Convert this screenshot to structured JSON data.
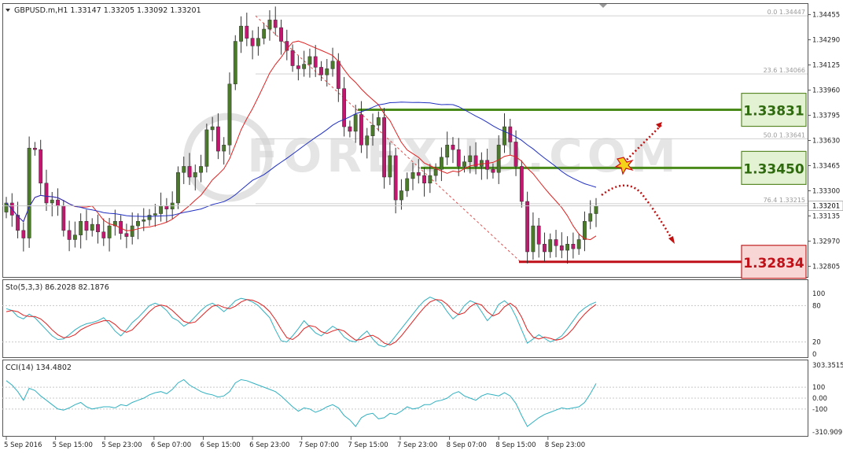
{
  "header": {
    "symbol_line": "GBPUSD.m,H1  1.33147 1.33205 1.33092 1.33201"
  },
  "watermark": "FOREX ID.COM",
  "colors": {
    "bull_candle": "#4a7a2a",
    "bear_candle": "#c0186e",
    "ma_fast": "#e02020",
    "ma_slow": "#2030c0",
    "stoch_main": "#30b0c0",
    "stoch_signal": "#e02020",
    "cci_line": "#30b0c0",
    "resistance": "#4a8a1a",
    "support": "#c0101a",
    "fib_line": "#e05050",
    "arrow": "#c01010"
  },
  "chart_data": [
    {
      "type": "candlestick",
      "title": "GBPUSD.m,H1",
      "ohlc_last": {
        "open": 1.33147,
        "high": 1.33205,
        "low": 1.33092,
        "close": 1.33201
      },
      "ylim": [
        1.3274,
        1.3452
      ],
      "y_ticks": [
        "1.34455",
        "1.34290",
        "1.34125",
        "1.33960",
        "1.33795",
        "1.33630",
        "1.33465",
        "1.33300",
        "1.33135",
        "1.32970",
        "1.32805"
      ],
      "current_price": "1.33201",
      "x_tick_labels": [
        "5 Sep 2016",
        "5 Sep 15:00",
        "5 Sep 23:00",
        "6 Sep 07:00",
        "6 Sep 15:00",
        "6 Sep 23:00",
        "7 Sep 07:00",
        "7 Sep 15:00",
        "7 Sep 23:00",
        "8 Sep 07:00",
        "8 Sep 15:00",
        "8 Sep 23:00"
      ],
      "fib_levels": [
        {
          "label": "0.0  1.34447",
          "value": 1.34447
        },
        {
          "label": "23.6  1.34066",
          "value": 1.34066
        },
        {
          "label": "50.0  1.33641",
          "value": 1.33641
        },
        {
          "label": "76.4  1.33215",
          "value": 1.33215
        }
      ],
      "annotated_levels": [
        {
          "label": "1.33831",
          "value": 1.33831,
          "kind": "resistance"
        },
        {
          "label": "1.33450",
          "value": 1.3345,
          "kind": "resistance"
        },
        {
          "label": "1.32834",
          "value": 1.32834,
          "kind": "support"
        }
      ],
      "closes": [
        1.3322,
        1.3314,
        1.3304,
        1.3299,
        1.3358,
        1.3357,
        1.3335,
        1.3322,
        1.3324,
        1.332,
        1.3304,
        1.3298,
        1.3301,
        1.331,
        1.3304,
        1.3308,
        1.3303,
        1.3299,
        1.3307,
        1.331,
        1.3302,
        1.33,
        1.3307,
        1.331,
        1.3311,
        1.3314,
        1.3315,
        1.332,
        1.3318,
        1.3322,
        1.3342,
        1.3346,
        1.3339,
        1.3342,
        1.3346,
        1.337,
        1.3372,
        1.3356,
        1.336,
        1.34,
        1.3428,
        1.3438,
        1.343,
        1.3425,
        1.343,
        1.3436,
        1.3442,
        1.3437,
        1.3428,
        1.3422,
        1.3412,
        1.341,
        1.3413,
        1.3418,
        1.3411,
        1.3406,
        1.341,
        1.3415,
        1.3397,
        1.3372,
        1.3369,
        1.338,
        1.336,
        1.3366,
        1.3373,
        1.3378,
        1.3339,
        1.3353,
        1.3324,
        1.333,
        1.3338,
        1.3342,
        1.334,
        1.3335,
        1.334,
        1.3344,
        1.3352,
        1.336,
        1.3357,
        1.3346,
        1.3349,
        1.3353,
        1.3346,
        1.335,
        1.3344,
        1.3342,
        1.336,
        1.3372,
        1.3362,
        1.3346,
        1.3323,
        1.329,
        1.3307,
        1.3295,
        1.329,
        1.3298,
        1.3294,
        1.3291,
        1.3295,
        1.3292,
        1.3298,
        1.331,
        1.3315,
        1.332
      ]
    },
    {
      "type": "line",
      "title": "Sto(5,3,3) 86.2028 82.1876",
      "ylim": [
        0,
        100
      ],
      "y_ticks": [
        "100",
        "80",
        "20",
        "0"
      ],
      "series": [
        {
          "name": "main",
          "values": [
            75,
            72,
            62,
            58,
            66,
            60,
            50,
            40,
            30,
            24,
            25,
            32,
            40,
            46,
            50,
            52,
            55,
            60,
            50,
            38,
            30,
            40,
            52,
            60,
            70,
            80,
            84,
            80,
            72,
            60,
            55,
            46,
            52,
            62,
            72,
            80,
            84,
            78,
            70,
            78,
            88,
            92,
            90,
            86,
            80,
            70,
            60,
            40,
            22,
            20,
            30,
            42,
            55,
            45,
            35,
            30,
            38,
            46,
            40,
            28,
            22,
            20,
            30,
            38,
            25,
            15,
            12,
            18,
            30,
            42,
            54,
            66,
            78,
            88,
            94,
            90,
            84,
            70,
            58,
            66,
            80,
            88,
            84,
            70,
            55,
            65,
            82,
            88,
            80,
            62,
            40,
            18,
            25,
            32,
            26,
            20,
            24,
            30,
            42,
            55,
            68,
            76,
            82,
            86
          ]
        },
        {
          "name": "signal",
          "values": [
            70,
            72,
            70,
            64,
            62,
            62,
            58,
            50,
            40,
            32,
            27,
            28,
            32,
            40,
            45,
            49,
            52,
            55,
            55,
            49,
            40,
            36,
            40,
            50,
            60,
            70,
            78,
            81,
            79,
            72,
            63,
            54,
            51,
            53,
            62,
            71,
            79,
            81,
            77,
            75,
            79,
            86,
            90,
            89,
            85,
            79,
            70,
            57,
            41,
            27,
            24,
            31,
            42,
            47,
            45,
            37,
            34,
            38,
            41,
            38,
            30,
            23,
            24,
            29,
            31,
            26,
            18,
            15,
            20,
            30,
            42,
            54,
            66,
            77,
            86,
            90,
            89,
            82,
            71,
            65,
            68,
            78,
            84,
            81,
            70,
            63,
            67,
            78,
            84,
            77,
            61,
            40,
            28,
            25,
            28,
            26,
            23,
            25,
            32,
            42,
            55,
            66,
            75,
            82
          ]
        }
      ]
    },
    {
      "type": "line",
      "title": "CCI(14) 134.4802",
      "ylim": [
        -310.9097,
        303.3515
      ],
      "y_ticks": [
        "303.3515",
        "100",
        "0.00",
        "-100",
        "-310.9097"
      ],
      "series": [
        {
          "name": "CCI",
          "values": [
            160,
            120,
            60,
            -20,
            90,
            70,
            20,
            -20,
            -60,
            -100,
            -110,
            -90,
            -60,
            -40,
            -80,
            -100,
            -90,
            -80,
            -80,
            -90,
            -60,
            -70,
            -40,
            -20,
            0,
            30,
            50,
            60,
            40,
            80,
            140,
            170,
            120,
            90,
            60,
            40,
            30,
            10,
            20,
            60,
            140,
            170,
            160,
            140,
            120,
            100,
            80,
            60,
            20,
            -30,
            -80,
            -120,
            -90,
            -100,
            -130,
            -110,
            -80,
            -60,
            -90,
            -160,
            -200,
            -260,
            -180,
            -150,
            -140,
            -190,
            -180,
            -140,
            -150,
            -120,
            -80,
            -100,
            -90,
            -60,
            -60,
            -30,
            -20,
            0,
            40,
            60,
            20,
            0,
            -20,
            20,
            40,
            30,
            20,
            50,
            20,
            -50,
            -160,
            -260,
            -220,
            -180,
            -150,
            -130,
            -110,
            -90,
            -100,
            -90,
            -80,
            -40,
            40,
            134
          ]
        }
      ]
    }
  ]
}
